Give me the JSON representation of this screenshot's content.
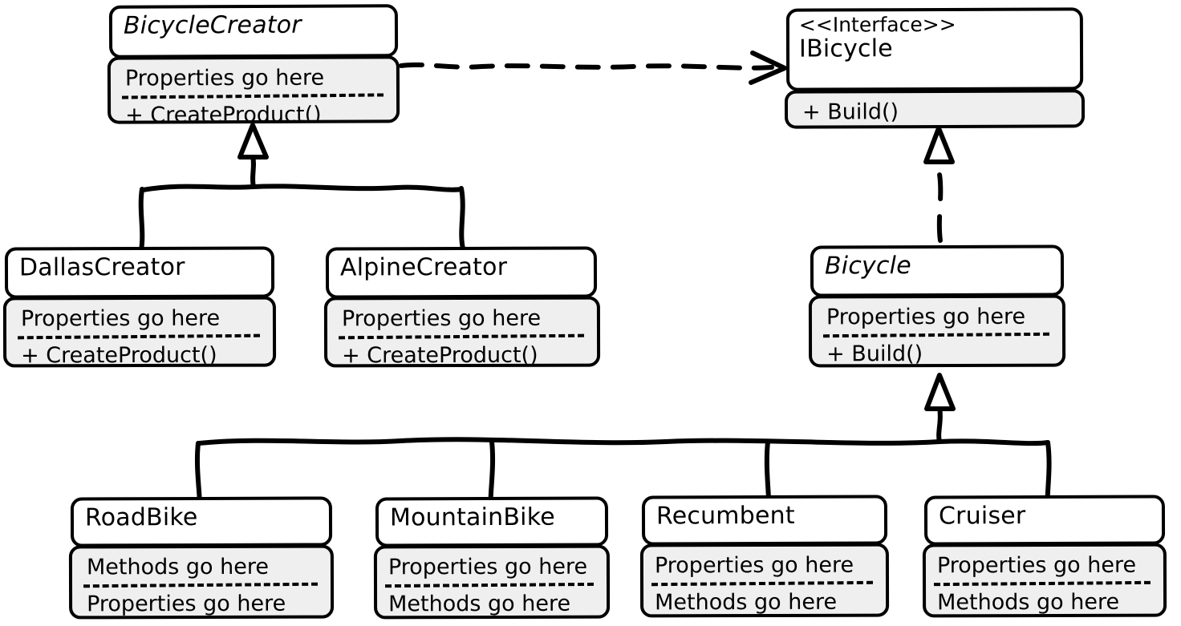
{
  "diagram": {
    "title": "Factory Method UML Class Diagram",
    "style": "hand-drawn sketch",
    "background_color": "#ffffff",
    "line_color": "#000000",
    "compartment_fill": "#efefef",
    "header_fill": "#ffffff"
  },
  "classes": {
    "bicycle_creator": {
      "name": "BicycleCreator",
      "stereotype": "",
      "abstract": true,
      "members": [
        "Properties go here",
        "+ CreateProduct()"
      ]
    },
    "ibicycle": {
      "name": "IBicycle",
      "stereotype": "<<Interface>>",
      "abstract": false,
      "members": [
        "+ Build()"
      ]
    },
    "dallas_creator": {
      "name": "DallasCreator",
      "stereotype": "",
      "abstract": false,
      "members": [
        "Properties go here",
        "+ CreateProduct()"
      ]
    },
    "alpine_creator": {
      "name": "AlpineCreator",
      "stereotype": "",
      "abstract": false,
      "members": [
        "Properties go here",
        "+ CreateProduct()"
      ]
    },
    "bicycle": {
      "name": "Bicycle",
      "stereotype": "",
      "abstract": true,
      "members": [
        "Properties go here",
        "+ Build()"
      ]
    },
    "road_bike": {
      "name": "RoadBike",
      "stereotype": "",
      "abstract": false,
      "members": [
        "Methods go here",
        "Properties go here"
      ]
    },
    "mountain_bike": {
      "name": "MountainBike",
      "stereotype": "",
      "abstract": false,
      "members": [
        "Properties go here",
        "Methods go here"
      ]
    },
    "recumbent": {
      "name": "Recumbent",
      "stereotype": "",
      "abstract": false,
      "members": [
        "Properties go here",
        "Methods go here"
      ]
    },
    "cruiser": {
      "name": "Cruiser",
      "stereotype": "",
      "abstract": false,
      "members": [
        "Properties go here",
        "Methods go here"
      ]
    }
  },
  "relationships": [
    {
      "kind": "dependency",
      "from": "BicycleCreator",
      "to": "IBicycle",
      "line": "dashed",
      "arrow": "open"
    },
    {
      "kind": "generalization",
      "from": "DallasCreator",
      "to": "BicycleCreator",
      "line": "solid",
      "arrow": "hollow-triangle"
    },
    {
      "kind": "generalization",
      "from": "AlpineCreator",
      "to": "BicycleCreator",
      "line": "solid",
      "arrow": "hollow-triangle"
    },
    {
      "kind": "realization",
      "from": "Bicycle",
      "to": "IBicycle",
      "line": "dashed",
      "arrow": "hollow-triangle"
    },
    {
      "kind": "generalization",
      "from": "RoadBike",
      "to": "Bicycle",
      "line": "solid",
      "arrow": "hollow-triangle"
    },
    {
      "kind": "generalization",
      "from": "MountainBike",
      "to": "Bicycle",
      "line": "solid",
      "arrow": "hollow-triangle"
    },
    {
      "kind": "generalization",
      "from": "Recumbent",
      "to": "Bicycle",
      "line": "solid",
      "arrow": "hollow-triangle"
    },
    {
      "kind": "generalization",
      "from": "Cruiser",
      "to": "Bicycle",
      "line": "solid",
      "arrow": "hollow-triangle"
    }
  ]
}
